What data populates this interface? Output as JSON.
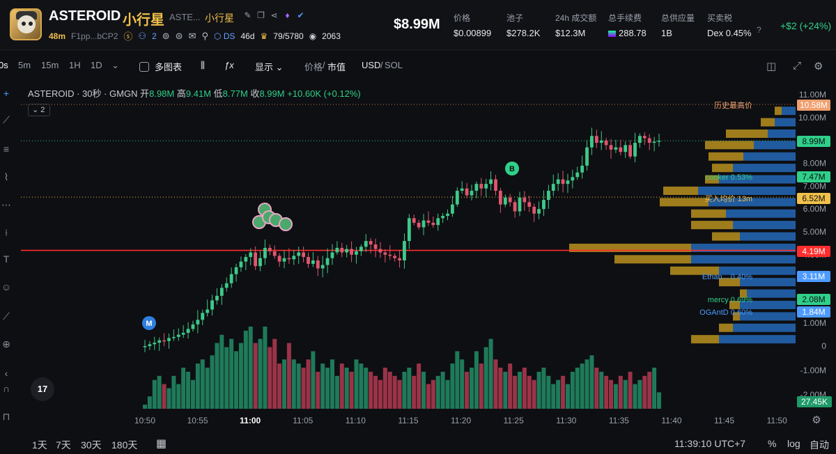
{
  "header": {
    "token_name": "ASTEROID",
    "token_name_cn": "小行星",
    "ticker": "ASTE...",
    "token_name_cn2": "小行星",
    "age": "48m",
    "address": "F1pp...bCP2",
    "holders_count": "2",
    "dev_label": "DS",
    "dev_age": "46d",
    "top_holders": "79/5780",
    "views": "2063",
    "market_cap": "$8.99M",
    "stats": [
      {
        "label": "价格",
        "value": "$0.00899"
      },
      {
        "label": "池子",
        "value": "$278.2K"
      },
      {
        "label": "24h 成交额",
        "value": "$12.3M"
      },
      {
        "label": "总手续费",
        "value": "288.78"
      },
      {
        "label": "总供应量",
        "value": "1B"
      },
      {
        "label": "买卖税",
        "value": "Dex 0.45%"
      }
    ],
    "pnl": "+$2 (+24%)"
  },
  "toolbar": {
    "intervals": [
      "0s",
      "5m",
      "15m",
      "1H",
      "1D"
    ],
    "multi_chart": "多图表",
    "display": "显示",
    "price_toggle": "价格",
    "mcap_toggle": "市值",
    "currency": "USD",
    "currency_alt": "SOL"
  },
  "legend": {
    "title": "ASTEROID · 30秒 · GMGN",
    "open_label": "开",
    "open": "8.98M",
    "high_label": "高",
    "high": "9.41M",
    "low_label": "低",
    "low": "8.77M",
    "close_label": "收",
    "close": "8.99M",
    "change": "+10.60K (+0.12%)",
    "indicator_count": "2"
  },
  "chart_data": {
    "type": "candlestick",
    "y_axis_ticks": [
      "11.00M",
      "10.00M",
      "9.00M",
      "8.00M",
      "7.00M",
      "6.00M",
      "5.00M",
      "4.00M",
      "3.00M",
      "2.00M",
      "1.00M",
      "0",
      "-1.00M",
      "-2.00M"
    ],
    "x_axis_ticks": [
      "10:50",
      "10:55",
      "11:00",
      "11:05",
      "11:10",
      "11:15",
      "11:20",
      "11:25",
      "11:30",
      "11:35",
      "11:40",
      "11:45",
      "11:50"
    ],
    "price_badges": [
      {
        "value": "10.58M",
        "label": "历史最高价",
        "color": "#f0a070"
      },
      {
        "value": "8.99M",
        "label": "",
        "color": "#2fd08a"
      },
      {
        "value": "7.47M",
        "label": "cooker 0.53%",
        "color": "#2fd08a"
      },
      {
        "value": "6.52M",
        "label": "买入均价 13m",
        "color": "#f0c04a"
      },
      {
        "value": "4.19M",
        "label": "",
        "color": "#ff2d2d"
      },
      {
        "value": "3.11M",
        "label": "Ethan... 0.40%",
        "color": "#4d9bff"
      },
      {
        "value": "2.08M",
        "label": "mercy 0.69%",
        "color": "#2fd08a"
      },
      {
        "value": "1.84M",
        "label": "OGAntD 0.60%",
        "color": "#4d9bff"
      }
    ],
    "volume_badge": "27.45K",
    "closes": [
      0.0,
      0.08,
      0.15,
      0.25,
      0.22,
      0.35,
      0.4,
      0.5,
      0.58,
      0.75,
      0.95,
      1.15,
      1.45,
      1.6,
      2.0,
      2.2,
      2.55,
      2.75,
      3.15,
      3.45,
      3.7,
      3.9,
      4.1,
      3.5,
      3.85,
      4.3,
      4.15,
      3.95,
      3.7,
      3.85,
      3.8,
      3.95,
      4.1,
      3.9,
      3.6,
      3.75,
      3.4,
      3.55,
      3.85,
      4.1,
      4.3,
      4.1,
      4.25,
      4.0,
      4.15,
      4.35,
      4.6,
      4.45,
      4.25,
      4.1,
      4.0,
      3.95,
      3.85,
      3.75,
      4.6,
      5.6,
      5.4,
      5.2,
      5.5,
      5.4,
      5.3,
      5.6,
      5.7,
      5.8,
      6.2,
      6.8,
      6.9,
      6.6,
      6.8,
      7.1,
      6.9,
      7.1,
      7.3,
      6.8,
      6.2,
      6.5,
      6.3,
      5.9,
      6.5,
      6.3,
      6.1,
      5.8,
      6.0,
      6.4,
      6.8,
      7.1,
      7.3,
      7.1,
      7.25,
      7.4,
      7.6,
      7.9,
      8.7,
      9.2,
      8.9,
      9.0,
      8.8,
      8.6,
      8.7,
      8.5,
      8.8,
      8.3,
      8.9,
      9.2,
      9.1,
      8.9,
      8.95,
      8.99
    ],
    "volumes": [
      0.05,
      0.15,
      0.35,
      0.4,
      0.3,
      0.25,
      0.4,
      0.3,
      0.5,
      0.45,
      0.35,
      0.55,
      0.6,
      0.5,
      0.65,
      0.8,
      0.9,
      0.75,
      0.85,
      0.7,
      0.8,
      0.95,
      1.0,
      0.8,
      0.85,
      1.0,
      0.75,
      0.85,
      0.55,
      0.6,
      0.8,
      0.6,
      0.55,
      0.5,
      0.6,
      0.7,
      0.45,
      0.55,
      0.5,
      0.6,
      0.4,
      0.55,
      0.5,
      0.45,
      0.6,
      0.55,
      0.5,
      0.45,
      0.4,
      0.35,
      0.5,
      0.45,
      0.4,
      0.35,
      0.45,
      0.5,
      0.4,
      0.55,
      0.45,
      0.3,
      0.35,
      0.4,
      0.45,
      0.35,
      0.55,
      0.7,
      0.6,
      0.45,
      0.5,
      0.7,
      0.55,
      0.75,
      0.85,
      0.6,
      0.5,
      0.45,
      0.55,
      0.4,
      0.45,
      0.5,
      0.4,
      0.35,
      0.45,
      0.5,
      0.4,
      0.3,
      0.35,
      0.4,
      0.3,
      0.45,
      0.5,
      0.55,
      0.6,
      0.65,
      0.5,
      0.45,
      0.4,
      0.35,
      0.3,
      0.4,
      0.35,
      0.45,
      0.3,
      0.35,
      0.4,
      0.45,
      0.5,
      0.2
    ],
    "markers": [
      {
        "label": "M",
        "color": "#2f7fe0"
      },
      {
        "label": "B",
        "color": "#2fd08a"
      }
    ],
    "depth_profile": [
      {
        "y": 10.3,
        "buy": 0.04,
        "sell": 0.02
      },
      {
        "y": 9.8,
        "buy": 0.06,
        "sell": 0.04
      },
      {
        "y": 9.3,
        "buy": 0.08,
        "sell": 0.12
      },
      {
        "y": 8.8,
        "buy": 0.12,
        "sell": 0.14
      },
      {
        "y": 8.3,
        "buy": 0.15,
        "sell": 0.1
      },
      {
        "y": 7.8,
        "buy": 0.18,
        "sell": 0.06
      },
      {
        "y": 7.3,
        "buy": 0.22,
        "sell": 0.04
      },
      {
        "y": 6.8,
        "buy": 0.28,
        "sell": 0.1
      },
      {
        "y": 6.3,
        "buy": 0.25,
        "sell": 0.14
      },
      {
        "y": 5.8,
        "buy": 0.2,
        "sell": 0.1
      },
      {
        "y": 5.3,
        "buy": 0.18,
        "sell": 0.12
      },
      {
        "y": 4.8,
        "buy": 0.16,
        "sell": 0.08
      },
      {
        "y": 4.3,
        "buy": 0.3,
        "sell": 0.35
      },
      {
        "y": 3.8,
        "buy": 0.3,
        "sell": 0.22
      },
      {
        "y": 3.3,
        "buy": 0.22,
        "sell": 0.14
      },
      {
        "y": 2.8,
        "buy": 0.16,
        "sell": 0.06
      },
      {
        "y": 2.3,
        "buy": 0.14,
        "sell": 0.02
      },
      {
        "y": 1.8,
        "buy": 0.16,
        "sell": 0.03
      },
      {
        "y": 1.3,
        "buy": 0.16,
        "sell": 0.02
      },
      {
        "y": 0.8,
        "buy": 0.18,
        "sell": 0.04
      },
      {
        "y": 0.3,
        "buy": 0.22,
        "sell": 0.08
      }
    ]
  },
  "bottom": {
    "ranges": [
      "1天",
      "7天",
      "30天",
      "180天"
    ],
    "time": "11:39:10 UTC+7",
    "percent": "%",
    "log": "log",
    "auto": "自动"
  }
}
